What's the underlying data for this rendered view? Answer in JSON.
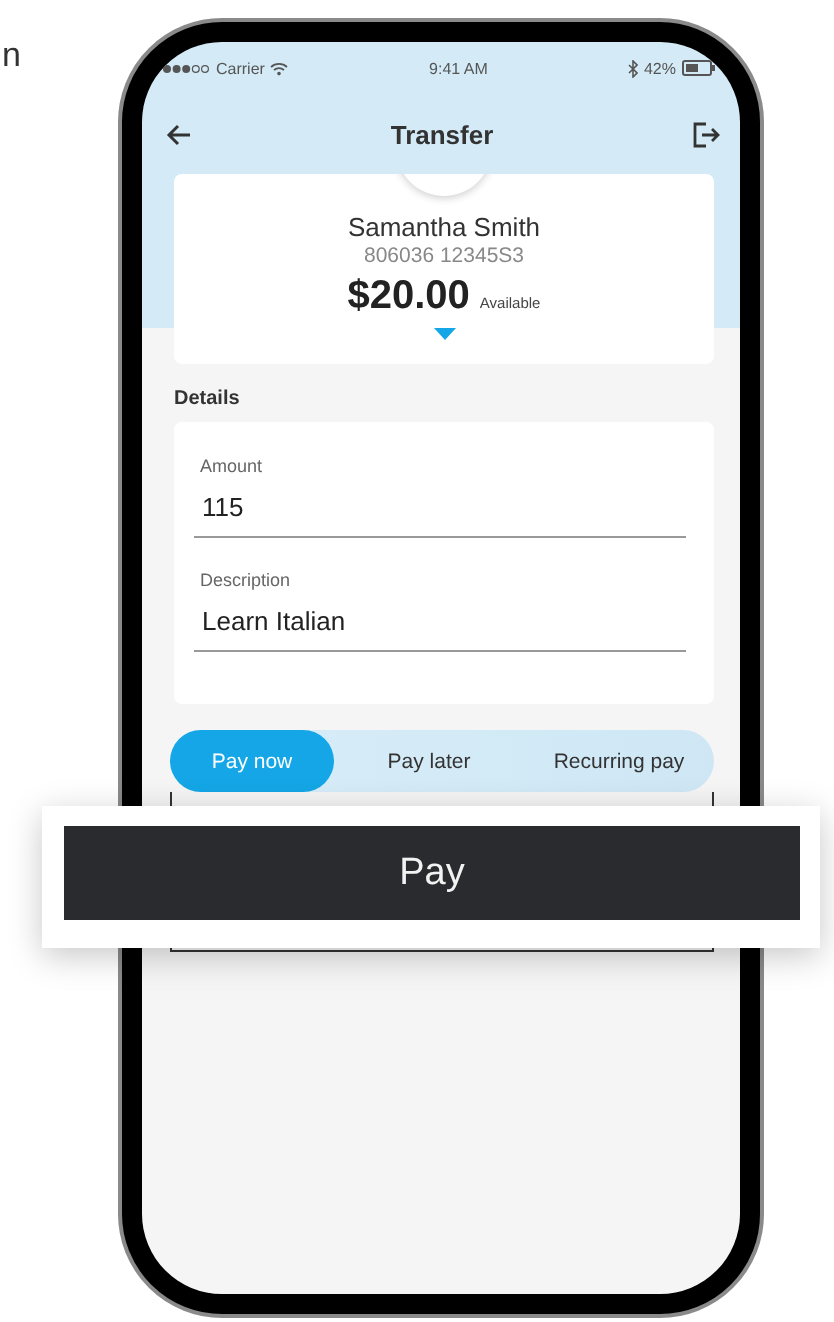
{
  "corner_text": "n",
  "status_bar": {
    "carrier": "Carrier",
    "time": "9:41 AM",
    "battery": "42%"
  },
  "nav": {
    "title": "Transfer"
  },
  "recipient": {
    "name": "Samantha Smith",
    "account": "806036 12345S3",
    "balance": "$20.00",
    "balance_label": "Available"
  },
  "details": {
    "heading": "Details",
    "fields": [
      {
        "label": "Amount",
        "value": "115"
      },
      {
        "label": "Description",
        "value": "Learn Italian"
      }
    ]
  },
  "pay_options": [
    {
      "label": "Pay now",
      "selected": true
    },
    {
      "label": "Pay later",
      "selected": false
    },
    {
      "label": "Recurring pay",
      "selected": false
    }
  ],
  "pay_button": {
    "label": "Pay"
  }
}
